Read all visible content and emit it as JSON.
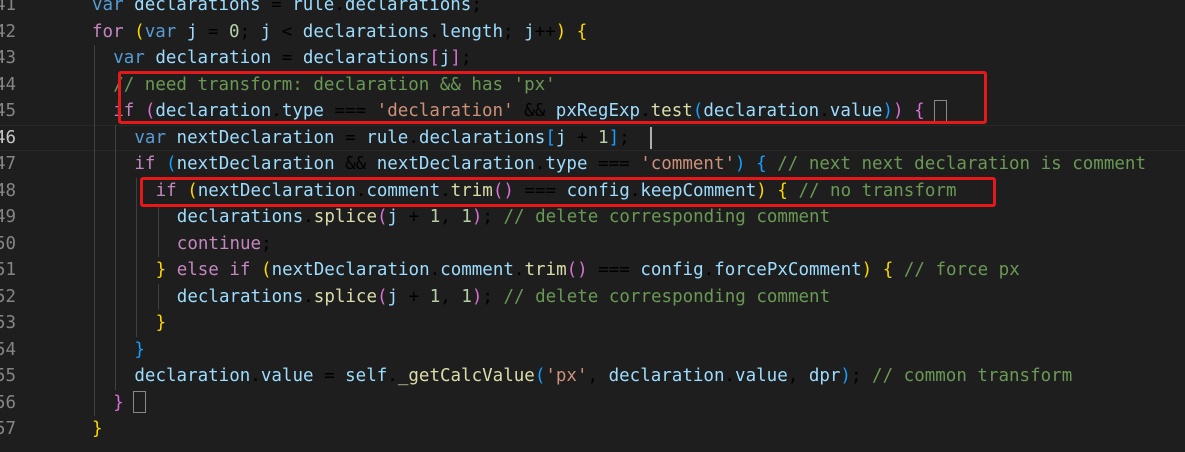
{
  "editor": {
    "language": "javascript",
    "theme": "dark",
    "active_line": "46",
    "lines": [
      {
        "num": "41",
        "tokens": [
          {
            "t": "var",
            "c": "kw"
          },
          {
            "t": " "
          },
          {
            "t": "declarations",
            "c": "var"
          },
          {
            "t": " = "
          },
          {
            "t": "rule",
            "c": "var"
          },
          {
            "t": "."
          },
          {
            "t": "declarations",
            "c": "var"
          },
          {
            "t": ";"
          }
        ]
      },
      {
        "num": "42",
        "tokens": [
          {
            "t": "for",
            "c": "ctl"
          },
          {
            "t": " "
          },
          {
            "t": "(",
            "c": "p1"
          },
          {
            "t": "var",
            "c": "kw"
          },
          {
            "t": " "
          },
          {
            "t": "j",
            "c": "var"
          },
          {
            "t": " = "
          },
          {
            "t": "0",
            "c": "num"
          },
          {
            "t": "; "
          },
          {
            "t": "j",
            "c": "var"
          },
          {
            "t": " < "
          },
          {
            "t": "declarations",
            "c": "var"
          },
          {
            "t": "."
          },
          {
            "t": "length",
            "c": "var"
          },
          {
            "t": "; "
          },
          {
            "t": "j",
            "c": "var"
          },
          {
            "t": "++"
          },
          {
            "t": ")",
            "c": "p1"
          },
          {
            "t": " "
          },
          {
            "t": "{",
            "c": "p1"
          }
        ]
      },
      {
        "num": "43",
        "tokens": [
          {
            "t": "var",
            "c": "kw"
          },
          {
            "t": " "
          },
          {
            "t": "declaration",
            "c": "var"
          },
          {
            "t": " = "
          },
          {
            "t": "declarations",
            "c": "var"
          },
          {
            "t": "[",
            "c": "p2"
          },
          {
            "t": "j",
            "c": "var"
          },
          {
            "t": "]",
            "c": "p2"
          },
          {
            "t": ";"
          }
        ]
      },
      {
        "num": "44",
        "tokens": [
          {
            "t": "// need transform: declaration && has 'px'",
            "c": "cm"
          }
        ]
      },
      {
        "num": "45",
        "tokens": [
          {
            "t": "if",
            "c": "ctl"
          },
          {
            "t": " "
          },
          {
            "t": "(",
            "c": "p2"
          },
          {
            "t": "declaration",
            "c": "var"
          },
          {
            "t": "."
          },
          {
            "t": "type",
            "c": "var"
          },
          {
            "t": " === "
          },
          {
            "t": "'declaration'",
            "c": "str"
          },
          {
            "t": " && "
          },
          {
            "t": "pxRegExp",
            "c": "var"
          },
          {
            "t": "."
          },
          {
            "t": "test",
            "c": "fn"
          },
          {
            "t": "(",
            "c": "p3"
          },
          {
            "t": "declaration",
            "c": "var"
          },
          {
            "t": "."
          },
          {
            "t": "value",
            "c": "var"
          },
          {
            "t": ")",
            "c": "p3"
          },
          {
            "t": ")",
            "c": "p2"
          },
          {
            "t": " "
          },
          {
            "t": "{",
            "c": "p2"
          }
        ]
      },
      {
        "num": "46",
        "tokens": [
          {
            "t": "var",
            "c": "kw"
          },
          {
            "t": " "
          },
          {
            "t": "nextDeclaration",
            "c": "var"
          },
          {
            "t": " = "
          },
          {
            "t": "rule",
            "c": "var"
          },
          {
            "t": "."
          },
          {
            "t": "declarations",
            "c": "var"
          },
          {
            "t": "[",
            "c": "p3"
          },
          {
            "t": "j",
            "c": "var"
          },
          {
            "t": " + "
          },
          {
            "t": "1",
            "c": "num"
          },
          {
            "t": "]",
            "c": "p3"
          },
          {
            "t": ";"
          }
        ]
      },
      {
        "num": "47",
        "tokens": [
          {
            "t": "if",
            "c": "ctl"
          },
          {
            "t": " "
          },
          {
            "t": "(",
            "c": "p3"
          },
          {
            "t": "nextDeclaration",
            "c": "var"
          },
          {
            "t": " && "
          },
          {
            "t": "nextDeclaration",
            "c": "var"
          },
          {
            "t": "."
          },
          {
            "t": "type",
            "c": "var"
          },
          {
            "t": " === "
          },
          {
            "t": "'comment'",
            "c": "str"
          },
          {
            "t": ")",
            "c": "p3"
          },
          {
            "t": " "
          },
          {
            "t": "{",
            "c": "p3"
          },
          {
            "t": " "
          },
          {
            "t": "// next next declaration is comment",
            "c": "cm"
          }
        ]
      },
      {
        "num": "48",
        "tokens": [
          {
            "t": "if",
            "c": "ctl"
          },
          {
            "t": " "
          },
          {
            "t": "(",
            "c": "p1"
          },
          {
            "t": "nextDeclaration",
            "c": "var"
          },
          {
            "t": "."
          },
          {
            "t": "comment",
            "c": "var"
          },
          {
            "t": "."
          },
          {
            "t": "trim",
            "c": "fn"
          },
          {
            "t": "()",
            "c": "p2"
          },
          {
            "t": " === "
          },
          {
            "t": "config",
            "c": "var"
          },
          {
            "t": "."
          },
          {
            "t": "keepComment",
            "c": "var"
          },
          {
            "t": ")",
            "c": "p1"
          },
          {
            "t": " "
          },
          {
            "t": "{",
            "c": "p1"
          },
          {
            "t": " "
          },
          {
            "t": "// no transform",
            "c": "cm"
          }
        ]
      },
      {
        "num": "49",
        "tokens": [
          {
            "t": "declarations",
            "c": "var"
          },
          {
            "t": "."
          },
          {
            "t": "splice",
            "c": "fn"
          },
          {
            "t": "(",
            "c": "p2"
          },
          {
            "t": "j",
            "c": "var"
          },
          {
            "t": " + "
          },
          {
            "t": "1",
            "c": "num"
          },
          {
            "t": ", "
          },
          {
            "t": "1",
            "c": "num"
          },
          {
            "t": ")",
            "c": "p2"
          },
          {
            "t": "; "
          },
          {
            "t": "// delete corresponding comment",
            "c": "cm"
          }
        ]
      },
      {
        "num": "50",
        "tokens": [
          {
            "t": "continue",
            "c": "ctl"
          },
          {
            "t": ";"
          }
        ]
      },
      {
        "num": "51",
        "tokens": [
          {
            "t": "}",
            "c": "p1"
          },
          {
            "t": " "
          },
          {
            "t": "else",
            "c": "ctl"
          },
          {
            "t": " "
          },
          {
            "t": "if",
            "c": "ctl"
          },
          {
            "t": " "
          },
          {
            "t": "(",
            "c": "p1"
          },
          {
            "t": "nextDeclaration",
            "c": "var"
          },
          {
            "t": "."
          },
          {
            "t": "comment",
            "c": "var"
          },
          {
            "t": "."
          },
          {
            "t": "trim",
            "c": "fn"
          },
          {
            "t": "()",
            "c": "p2"
          },
          {
            "t": " === "
          },
          {
            "t": "config",
            "c": "var"
          },
          {
            "t": "."
          },
          {
            "t": "forcePxComment",
            "c": "var"
          },
          {
            "t": ")",
            "c": "p1"
          },
          {
            "t": " "
          },
          {
            "t": "{",
            "c": "p1"
          },
          {
            "t": " "
          },
          {
            "t": "// force px",
            "c": "cm"
          }
        ]
      },
      {
        "num": "52",
        "tokens": [
          {
            "t": "declarations",
            "c": "var"
          },
          {
            "t": "."
          },
          {
            "t": "splice",
            "c": "fn"
          },
          {
            "t": "(",
            "c": "p2"
          },
          {
            "t": "j",
            "c": "var"
          },
          {
            "t": " + "
          },
          {
            "t": "1",
            "c": "num"
          },
          {
            "t": ", "
          },
          {
            "t": "1",
            "c": "num"
          },
          {
            "t": ")",
            "c": "p2"
          },
          {
            "t": "; "
          },
          {
            "t": "// delete corresponding comment",
            "c": "cm"
          }
        ]
      },
      {
        "num": "53",
        "tokens": [
          {
            "t": "}",
            "c": "p1"
          }
        ]
      },
      {
        "num": "54",
        "tokens": [
          {
            "t": "}",
            "c": "p3"
          }
        ]
      },
      {
        "num": "55",
        "tokens": [
          {
            "t": "declaration",
            "c": "var"
          },
          {
            "t": "."
          },
          {
            "t": "value",
            "c": "var"
          },
          {
            "t": " = "
          },
          {
            "t": "self",
            "c": "var"
          },
          {
            "t": "."
          },
          {
            "t": "_getCalcValue",
            "c": "fn"
          },
          {
            "t": "(",
            "c": "p3"
          },
          {
            "t": "'px'",
            "c": "str"
          },
          {
            "t": ", "
          },
          {
            "t": "declaration",
            "c": "var"
          },
          {
            "t": "."
          },
          {
            "t": "value",
            "c": "var"
          },
          {
            "t": ", "
          },
          {
            "t": "dpr",
            "c": "var"
          },
          {
            "t": ")",
            "c": "p3"
          },
          {
            "t": "; "
          },
          {
            "t": "// common transform",
            "c": "cm"
          }
        ]
      },
      {
        "num": "56",
        "tokens": [
          {
            "t": "}",
            "c": "p2"
          }
        ]
      },
      {
        "num": "57",
        "tokens": [
          {
            "t": "}",
            "c": "p1"
          }
        ]
      }
    ]
  }
}
